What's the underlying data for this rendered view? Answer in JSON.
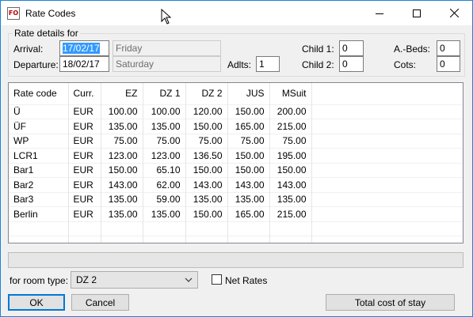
{
  "window": {
    "title": "Rate Codes",
    "app_icon_text": "FO"
  },
  "rate_details": {
    "group_label": "Rate details for",
    "arrival_label": "Arrival:",
    "arrival_date": "17/02/17",
    "arrival_day": "Friday",
    "departure_label": "Departure:",
    "departure_date": "18/02/17",
    "departure_day": "Saturday",
    "adults_label": "Adlts:",
    "adults_value": "1",
    "child1_label": "Child 1:",
    "child1_value": "0",
    "child2_label": "Child 2:",
    "child2_value": "0",
    "abeds_label": "A.-Beds:",
    "abeds_value": "0",
    "cots_label": "Cots:",
    "cots_value": "0"
  },
  "table": {
    "columns": [
      "Rate code",
      "Curr.",
      "EZ",
      "DZ 1",
      "DZ 2",
      "JUS",
      "MSuit"
    ],
    "rows": [
      [
        "Ü",
        "EUR",
        "100.00",
        "100.00",
        "120.00",
        "150.00",
        "200.00"
      ],
      [
        "ÜF",
        "EUR",
        "135.00",
        "135.00",
        "150.00",
        "165.00",
        "215.00"
      ],
      [
        "WP",
        "EUR",
        "75.00",
        "75.00",
        "75.00",
        "75.00",
        "75.00"
      ],
      [
        "LCR1",
        "EUR",
        "123.00",
        "123.00",
        "136.50",
        "150.00",
        "195.00"
      ],
      [
        "Bar1",
        "EUR",
        "150.00",
        "65.10",
        "150.00",
        "150.00",
        "150.00"
      ],
      [
        "Bar2",
        "EUR",
        "143.00",
        "62.00",
        "143.00",
        "143.00",
        "143.00"
      ],
      [
        "Bar3",
        "EUR",
        "135.00",
        "59.00",
        "135.00",
        "135.00",
        "135.00"
      ],
      [
        "Berlin",
        "EUR",
        "135.00",
        "135.00",
        "150.00",
        "165.00",
        "215.00"
      ]
    ]
  },
  "room_type": {
    "label": "for room type:",
    "selected": "DZ 2"
  },
  "net_rates": {
    "label": "Net Rates",
    "checked": false
  },
  "buttons": {
    "ok": "OK",
    "cancel": "Cancel",
    "total_cost": "Total cost of stay"
  },
  "colors": {
    "accent": "#0078d7",
    "selection": "#3399ff",
    "window_border": "#1883d7"
  }
}
